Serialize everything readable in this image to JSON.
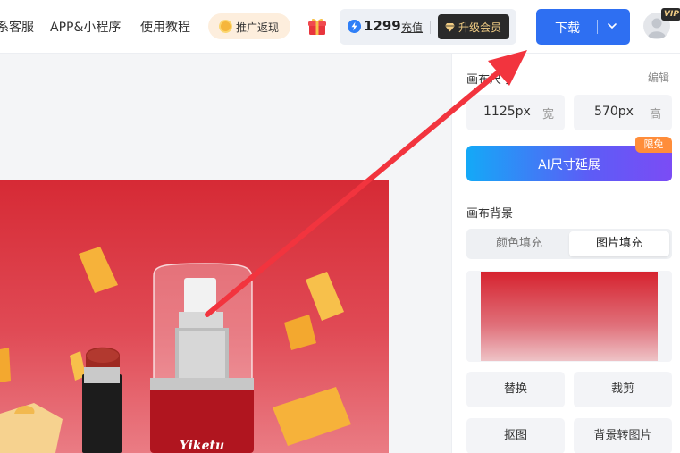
{
  "header": {
    "nav": [
      "系客服",
      "APP&小程序",
      "使用教程"
    ],
    "promo_label": "推广返现",
    "balance": "1299",
    "recharge_label": "充值",
    "upgrade_label": "升级会员",
    "download_label": "下载",
    "vip_badge": "VIP"
  },
  "panel": {
    "canvas_title": "画布尺寸",
    "edit_label": "编辑",
    "width_value": "1125px",
    "width_unit": "宽",
    "height_value": "570px",
    "height_unit": "高",
    "ai_button_label": "AI尺寸延展",
    "free_tag": "限免",
    "background_title": "画布背景",
    "fill_tabs": [
      "颜色填充",
      "图片填充"
    ],
    "active_fill_tab": "图片填充",
    "actions": [
      "替换",
      "裁剪",
      "抠图",
      "背景转图片"
    ]
  },
  "poster": {
    "brand": "Yiketu"
  },
  "colors": {
    "accent_blue": "#2e6ff2",
    "poster_red": "#d62a35",
    "arrow_red": "#f2343e",
    "free_tag_orange": "#ff8d3a"
  },
  "icons": [
    "coin-icon",
    "gift-icon",
    "lightning-icon",
    "diamond-icon",
    "chevron-down-icon",
    "avatar-icon"
  ]
}
